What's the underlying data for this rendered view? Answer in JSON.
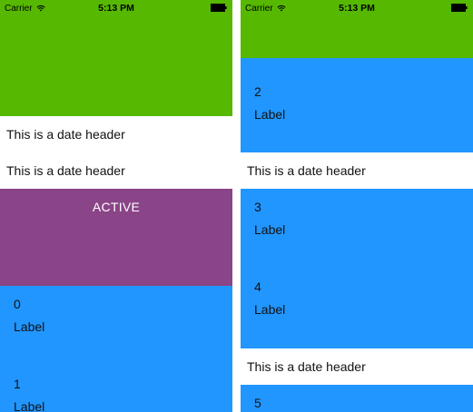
{
  "status_bar": {
    "carrier": "Carrier",
    "time": "5:13 PM"
  },
  "left_screen": {
    "headers": [
      "This is a date header",
      "This is a date header"
    ],
    "active_label": "ACTIVE",
    "cells": [
      {
        "number": "0",
        "label": "Label"
      },
      {
        "number": "1",
        "label": "Label"
      }
    ]
  },
  "right_screen": {
    "cells": [
      {
        "number": "2",
        "label": "Label"
      },
      {
        "number": "3",
        "label": "Label"
      },
      {
        "number": "4",
        "label": "Label"
      },
      {
        "number": "5"
      }
    ],
    "headers": [
      "This is a date header",
      "This is a date header"
    ]
  },
  "colors": {
    "green": "#56b800",
    "blue": "#2196ff",
    "purple": "#8a4488"
  }
}
